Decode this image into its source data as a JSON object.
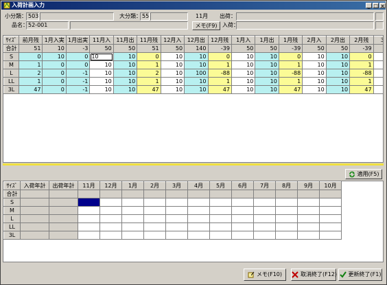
{
  "window": {
    "title": "入荷計画入力"
  },
  "header": {
    "small_class_label": "小分類：",
    "small_class_code": "503",
    "large_class_label": "大分類：",
    "large_class_code": "55",
    "item_label": "品名：",
    "item_code": "52-001",
    "month": "11月",
    "memo_button": "メモ(F9)",
    "shipment_label": "出荷：",
    "arrival_label": "入荷："
  },
  "grid": {
    "columns": [
      "ｻｲｽﾞ",
      "前月残",
      "1月入実",
      "1月出実",
      "11月入",
      "11月出",
      "11月残",
      "12月入",
      "12月出",
      "12月残",
      "1月入",
      "1月出",
      "1月残",
      "2月入",
      "2月出",
      "2月残",
      "3月"
    ],
    "rows": [
      [
        "合計",
        "51",
        "10",
        "-3",
        "50",
        "50",
        "51",
        "50",
        "140",
        "-39",
        "50",
        "50",
        "-39",
        "50",
        "50",
        "-39",
        ""
      ],
      [
        "S",
        "0",
        "10",
        "0",
        "10",
        "10",
        "0",
        "10",
        "10",
        "0",
        "10",
        "10",
        "0",
        "10",
        "10",
        "0",
        ""
      ],
      [
        "M",
        "1",
        "0",
        "0",
        "10",
        "10",
        "1",
        "10",
        "10",
        "1",
        "10",
        "10",
        "1",
        "10",
        "10",
        "1",
        ""
      ],
      [
        "L",
        "2",
        "0",
        "-1",
        "10",
        "10",
        "2",
        "10",
        "100",
        "-88",
        "10",
        "10",
        "-88",
        "10",
        "10",
        "-88",
        ""
      ],
      [
        "LL",
        "1",
        "0",
        "-1",
        "10",
        "10",
        "1",
        "10",
        "10",
        "1",
        "10",
        "10",
        "1",
        "10",
        "10",
        "1",
        ""
      ],
      [
        "3L",
        "47",
        "0",
        "-1",
        "10",
        "10",
        "47",
        "10",
        "10",
        "47",
        "10",
        "10",
        "47",
        "10",
        "10",
        "47",
        ""
      ]
    ]
  },
  "apply_button": "適用(F5)",
  "grid2": {
    "columns": [
      "ｻｲｽﾞ",
      "入荷年計",
      "出荷年計",
      "11月",
      "12月",
      "1月",
      "2月",
      "3月",
      "4月",
      "5月",
      "6月",
      "7月",
      "8月",
      "9月",
      "10月"
    ],
    "rows": [
      "合計",
      "S",
      "M",
      "L",
      "LL",
      "3L"
    ]
  },
  "footer": {
    "memo_button": "メモ(F10)",
    "cancel_button": "取消終了(F12)",
    "update_button": "更新終了(F1)"
  }
}
